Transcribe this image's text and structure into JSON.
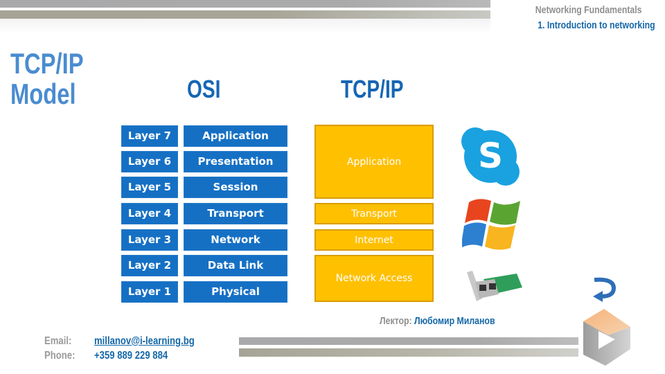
{
  "header": {
    "course": "Networking Fundamentals",
    "lecture": "1. Introduction to networking"
  },
  "slide": {
    "title_line1": "TCP/IP",
    "title_line2": "Model",
    "osi_heading": "OSI",
    "tcpip_heading": "TCP/IP"
  },
  "osi_layers": [
    {
      "number": "Layer 7",
      "name": "Application"
    },
    {
      "number": "Layer 6",
      "name": "Presentation"
    },
    {
      "number": "Layer 5",
      "name": "Session"
    },
    {
      "number": "Layer 4",
      "name": "Transport"
    },
    {
      "number": "Layer 3",
      "name": "Network"
    },
    {
      "number": "Layer 2",
      "name": "Data Link"
    },
    {
      "number": "Layer 1",
      "name": "Physical"
    }
  ],
  "tcpip_layers": [
    {
      "name": "Application"
    },
    {
      "name": "Transport"
    },
    {
      "name": "Internet"
    },
    {
      "name": "Network Access"
    }
  ],
  "icons": {
    "skype": "skype-logo-icon",
    "windows": "windows-logo-icon",
    "nic": "network-card-icon",
    "back": "curved-back-arrow-icon",
    "brand": "brand-logo-icon"
  },
  "lecturer": {
    "label": "Лектор:",
    "name": "Любомир Миланов"
  },
  "contact": {
    "email_label": "Email:",
    "email": "millanov@i-learning.bg",
    "phone_label": "Phone:",
    "phone": "+359 889 229 884"
  },
  "colors": {
    "osi_blue": "#1570c4",
    "tcpip_yellow": "#ffc000",
    "title_blue": "#4a8cd0",
    "heading_blue": "#1666b4"
  }
}
